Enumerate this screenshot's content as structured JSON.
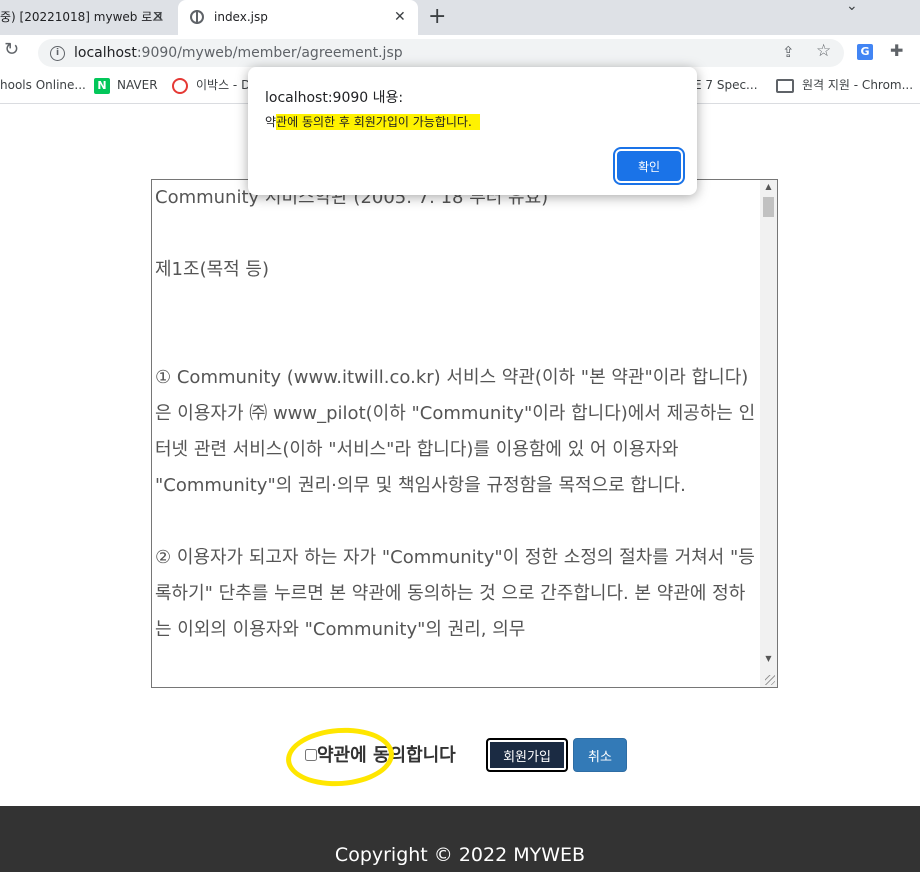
{
  "browser": {
    "tabs": [
      {
        "title": "중) [20221018] myweb 로그",
        "close": "✕"
      },
      {
        "title": "index.jsp",
        "close": "✕"
      }
    ],
    "new_tab": "+",
    "tab_search": "⌄",
    "address": {
      "host": "localhost",
      "rest": ":9090/myweb/member/agreement.jsp"
    },
    "bookmarks": [
      {
        "label": "hools Online..."
      },
      {
        "label": "NAVER",
        "icon": "N"
      },
      {
        "label": "이박스 - D"
      },
      {
        "label": "E 7 Spec..."
      },
      {
        "label": "원격 지원 - Chrom..."
      }
    ]
  },
  "alert": {
    "title": "localhost:9090 내용:",
    "message_lead": "약",
    "message_highlighted": "관에 동의한 후 회원가입이 가능합니다.",
    "ok_label": "확인"
  },
  "terms": {
    "paragraphs": [
      "Community 서비스약관 (2005. 7. 18 부터 유효)",
      "",
      "제1조(목적 등)",
      "",
      "",
      "① Community (www.itwill.co.kr) 서비스 약관(이하 \"본 약관\"이라 합니다)은 이용자가 ㈜ www_pilot(이하 \"Community\"이라 합니다)에서 제공하는 인터넷 관련 서비스(이하 \"서비스\"라 합니다)를 이용함에 있 어 이용자와 \"Community\"의 권리·의무 및 책임사항을 규정함을 목적으로 합니다.",
      "",
      "② 이용자가 되고자 하는 자가 \"Community\"이 정한 소정의 절차를 거쳐서 \"등록하기\" 단추를 누르면 본 약관에 동의하는 것 으로 간주합니다. 본 약관에 정하는 이외의 이용자와 \"Community\"의 권리, 의무"
    ]
  },
  "form": {
    "agree_label": "약관에 동의합니다",
    "join_button": "회원가입",
    "cancel_button": "취소"
  },
  "footer": {
    "copyright": "Copyright © 2022 MYWEB"
  },
  "colors": {
    "highlight": "#ffe600",
    "footer_bg": "#333333",
    "join_button_bg": "#1b2b43",
    "cancel_button_bg": "#337ab7",
    "dialog_ok_bg": "#1a73e8"
  }
}
